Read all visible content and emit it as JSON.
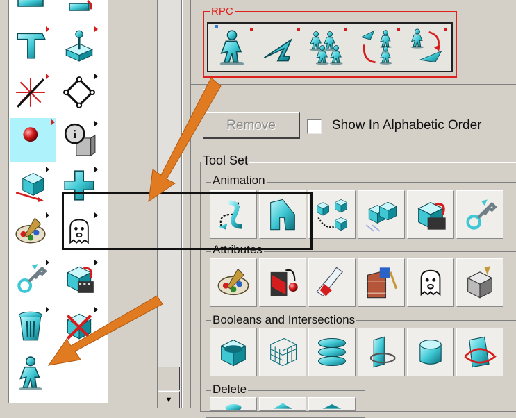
{
  "rpc_group": {
    "label": "RPC",
    "tools": [
      "rpc-person-icon",
      "rpc-path-icon",
      "rpc-crowd-icon",
      "rpc-crowd-path-icon",
      "rpc-person-cycle-icon"
    ]
  },
  "controls": {
    "remove_label": "Remove",
    "alpha_label": "Show In Alphabetic Order",
    "alpha_checked": false
  },
  "toolset": {
    "label": "Tool Set",
    "groups": [
      {
        "label": "Animation",
        "tools": [
          "path-animation-icon",
          "deform-animation-icon",
          "link-cubes-icon",
          "motion-cubes-icon",
          "render-animation-icon",
          "keyframe-icon"
        ]
      },
      {
        "label": "Attributes",
        "tools": [
          "palette-icon",
          "paint-drip-icon",
          "bottle-icon",
          "texture-map-icon",
          "ghost-icon",
          "material-box-icon"
        ]
      },
      {
        "label": "Booleans and Intersections",
        "tools": [
          "boolean-union-icon",
          "grid-cube-icon",
          "slice-layers-icon",
          "intersect-icon",
          "cylinder-cut-icon",
          "curve-intersect-icon"
        ]
      },
      {
        "label": "Delete",
        "tools": []
      }
    ]
  },
  "palette": {
    "tools": [
      "hammer-icon",
      "joystick-icon",
      "t-beam-icon",
      "path-node-icon",
      "spark-icon",
      "diamond-node-icon",
      "sphere-icon",
      "info-icon",
      "move-cube-icon",
      "cross-block-icon",
      "palette-icon",
      "ghost-icon",
      "keyframe-icon",
      "render-animation-icon",
      "trash-icon",
      "delete-cube-icon",
      "rpc-person-icon"
    ],
    "selected": "sphere-icon"
  },
  "colors": {
    "accent": "#e0201c",
    "arrow": "#e07b21",
    "icon": "#3fc8d4"
  }
}
